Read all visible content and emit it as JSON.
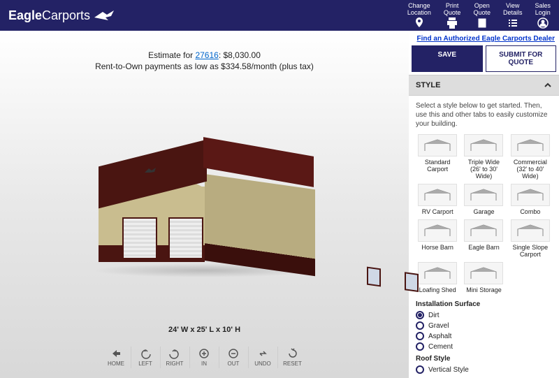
{
  "header": {
    "brand_bold": "Eagle",
    "brand_rest": "Carports",
    "actions": [
      {
        "l1": "Change",
        "l2": "Location",
        "icon": "pin"
      },
      {
        "l1": "Print",
        "l2": "Quote",
        "icon": "print"
      },
      {
        "l1": "Open",
        "l2": "Quote",
        "icon": "open"
      },
      {
        "l1": "View",
        "l2": "Details",
        "icon": "list"
      },
      {
        "l1": "Sales",
        "l2": "Login",
        "icon": "user"
      }
    ]
  },
  "estimate": {
    "prefix": "Estimate for ",
    "zip": "27616",
    "price": ": $8,030.00",
    "rto": "Rent-to-Own payments as low as $334.58/month (plus tax)"
  },
  "dimensions": "24' W x 25' L x 10' H",
  "controls": [
    "HOME",
    "LEFT",
    "RIGHT",
    "IN",
    "OUT",
    "UNDO",
    "RESET"
  ],
  "dealer_link": "Find an Authorized Eagle Carports Dealer",
  "buttons": {
    "save": "SAVE",
    "quote": "SUBMIT FOR QUOTE"
  },
  "accordion": "STYLE",
  "hint": "Select a style below to get started. Then, use this and other tabs to easily customize your building.",
  "styles": [
    "Standard Carport",
    "Triple Wide (26' to 30' Wide)",
    "Commercial (32' to 40' Wide)",
    "RV Carport",
    "Garage",
    "Combo",
    "Horse Barn",
    "Eagle Barn",
    "Single Slope Carport",
    "Loafing Shed",
    "Mini Storage"
  ],
  "surface": {
    "label": "Installation Surface",
    "opts": [
      "Dirt",
      "Gravel",
      "Asphalt",
      "Cement"
    ],
    "selected": "Dirt"
  },
  "roof": {
    "label": "Roof Style",
    "opts": [
      "Vertical Style"
    ],
    "selected": ""
  }
}
